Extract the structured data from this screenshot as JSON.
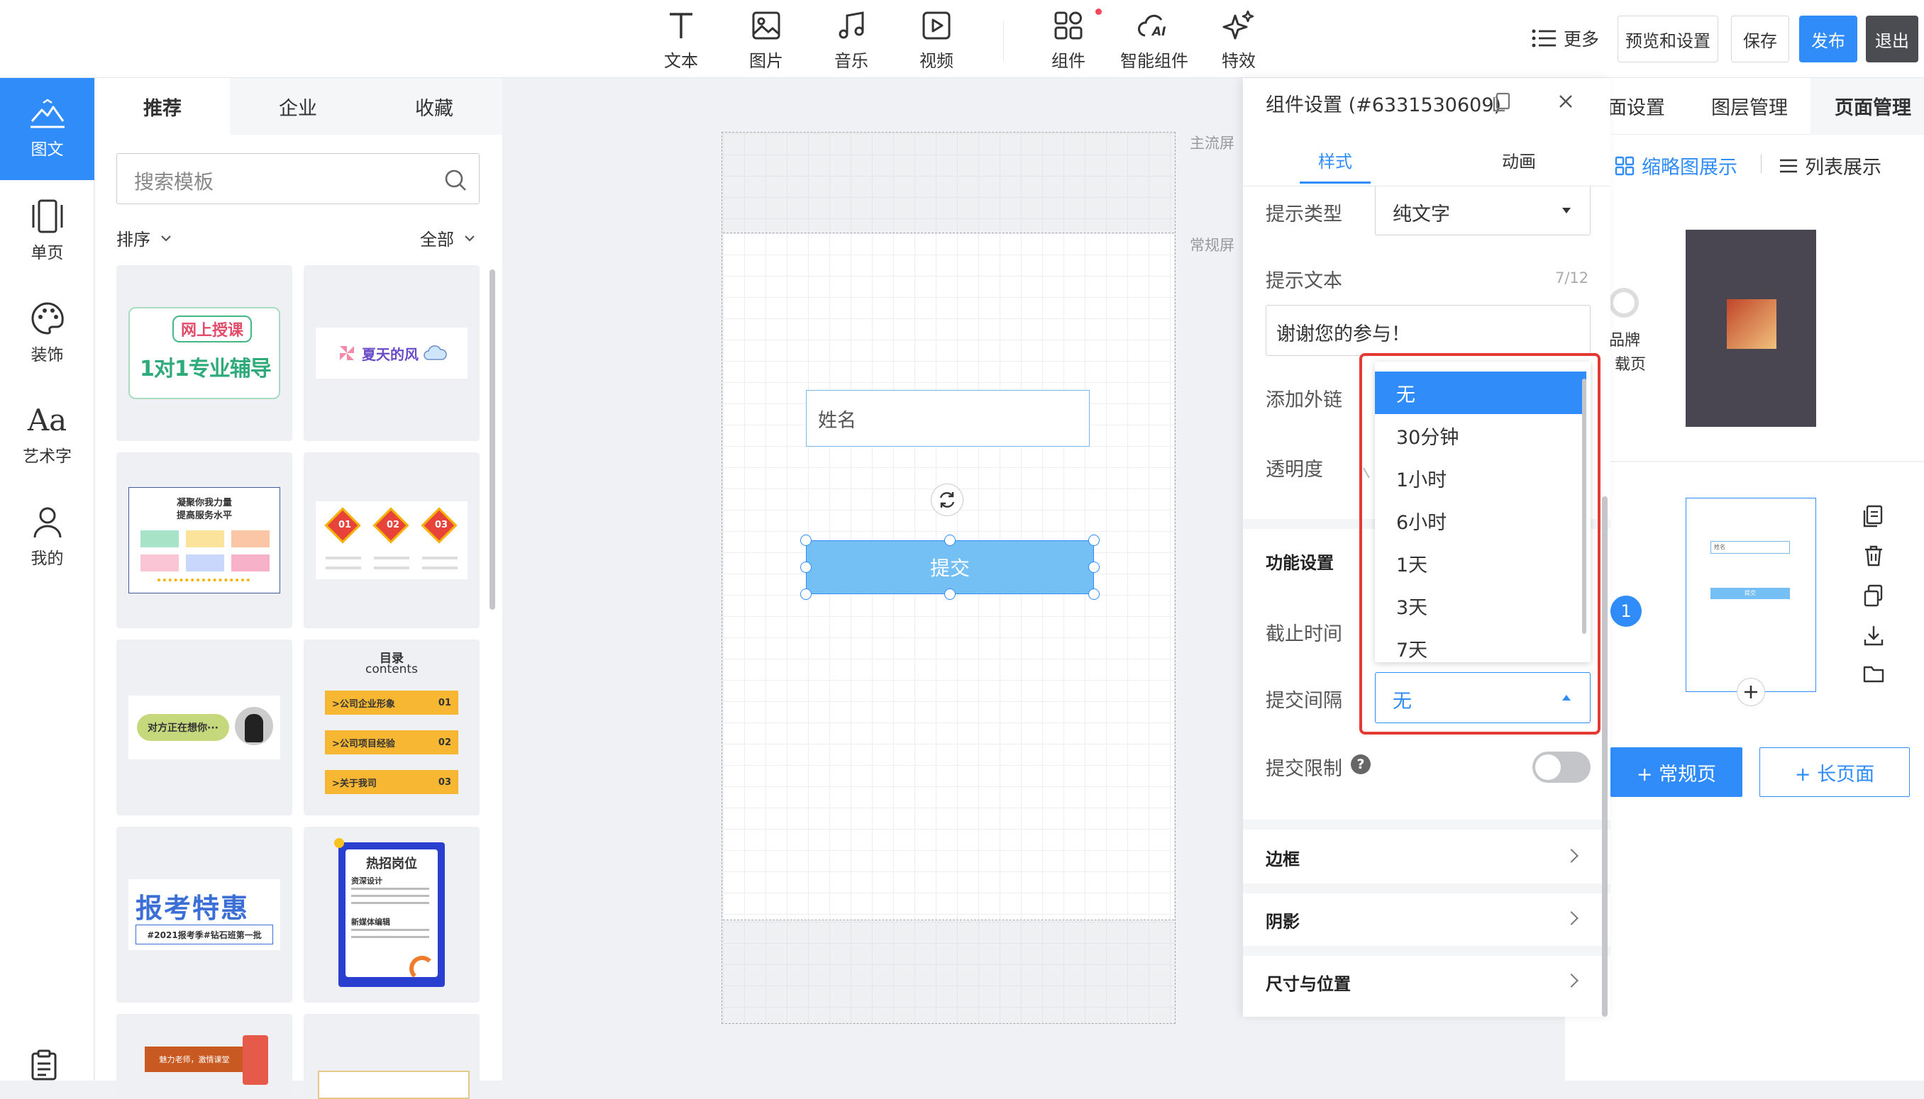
{
  "toolbar": {
    "tools": [
      {
        "label": "文本",
        "icon": "text-icon"
      },
      {
        "label": "图片",
        "icon": "image-icon"
      },
      {
        "label": "音乐",
        "icon": "music-icon"
      },
      {
        "label": "视频",
        "icon": "video-icon"
      },
      {
        "label": "组件",
        "icon": "component-icon"
      },
      {
        "label": "智能组件",
        "icon": "ai-component-icon"
      },
      {
        "label": "特效",
        "icon": "effects-icon"
      }
    ],
    "more_label": "更多",
    "preview_label": "预览和设置",
    "save_label": "保存",
    "publish_label": "发布",
    "exit_label": "退出"
  },
  "leftnav": {
    "items": [
      {
        "label": "图文",
        "icon": "mountain-icon",
        "active": true
      },
      {
        "label": "单页",
        "icon": "single-page-icon"
      },
      {
        "label": "装饰",
        "icon": "palette-icon"
      },
      {
        "label": "艺术字",
        "icon": "art-text-icon"
      },
      {
        "label": "我的",
        "icon": "user-icon"
      }
    ]
  },
  "templates": {
    "tabs": [
      "推荐",
      "企业",
      "收藏"
    ],
    "search_placeholder": "搜索模板",
    "sort_label": "排序",
    "filter_label": "全部",
    "thumbs": [
      {
        "t1": "网上授课",
        "t2": "1对1专业辅导"
      },
      {
        "t1": "夏天的风"
      },
      {
        "t1": "凝聚你我力量",
        "t2": "提高服务水平"
      },
      {
        "n1": "01",
        "n2": "02",
        "n3": "03"
      },
      {
        "t1": "对方正在想你···"
      },
      {
        "t1": "目录",
        "t2": "contents",
        "r1": ">公司企业形象",
        "r2": ">公司项目经验",
        "r3": ">关于我司",
        "n1": "01",
        "n2": "02",
        "n3": "03"
      },
      {
        "t1": "报考特惠",
        "t2": "#2021报考季#钻石班第一批"
      },
      {
        "t1": "热招岗位",
        "t2": "资深设计",
        "t3": "新媒体编辑"
      },
      {
        "t1": "魅力老师，激情课堂"
      },
      {
        "t1": ""
      }
    ]
  },
  "canvas": {
    "main_screen_label": "主流屏",
    "normal_screen_label": "常规屏",
    "name_field_placeholder": "姓名",
    "submit_label": "提交"
  },
  "props": {
    "title": "组件设置 (#6331530609)",
    "tabs": [
      "样式",
      "动画"
    ],
    "hint_type_label": "提示类型",
    "hint_type_value": "纯文字",
    "hint_text_label": "提示文本",
    "hint_text_count": "7/12",
    "hint_text_value": "谢谢您的参与！",
    "add_link_label": "添加外链",
    "opacity_label": "透明度",
    "func_section": "功能设置",
    "deadline_label": "截止时间",
    "interval_label": "提交间隔",
    "interval_value": "无",
    "limit_label": "提交限制",
    "limit_on": false,
    "border_section": "边框",
    "shadow_section": "阴影",
    "size_section": "尺寸与位置",
    "dropdown_options": [
      "无",
      "30分钟",
      "1小时",
      "6小时",
      "1天",
      "3天",
      "7天"
    ],
    "dropdown_selected": "无"
  },
  "rightpanel": {
    "tabs": [
      "面设置",
      "图层管理",
      "页面管理"
    ],
    "view_thumb_label": "缩略图展示",
    "view_list_label": "列表展示",
    "brand_label": "品牌",
    "load_label": "载页",
    "page_number": "1",
    "thumb_name": "姓名",
    "thumb_submit": "提交",
    "add_normal_label": "+ 常规页",
    "add_long_label": "+ 长页面"
  },
  "colors": {
    "accent": "#2f8cf8",
    "highlight_border": "#e53935",
    "submit_button": "#74bff4"
  }
}
